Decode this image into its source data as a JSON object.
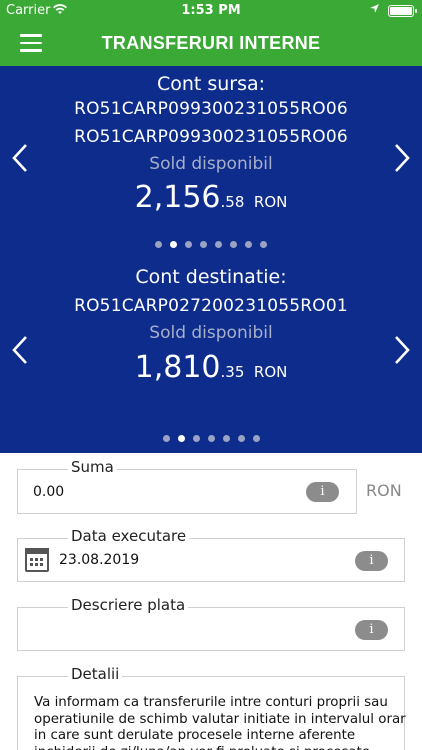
{
  "status_bar": {
    "carrier": "Carrier",
    "time": "1:53 PM"
  },
  "header": {
    "title": "TRANSFERURI INTERNE"
  },
  "source_account": {
    "label": "Cont sursa:",
    "iban_primary": "RO51CARP099300231055RO06",
    "iban_secondary": "RO51CARP099300231055RO06",
    "balance_label": "Sold disponibil",
    "balance_int": "2,156",
    "balance_dec": ".58",
    "currency": "RON",
    "page_count": 8,
    "active_page": 2
  },
  "destination_account": {
    "label": "Cont destinatie:",
    "iban": "RO51CARP027200231055RO01",
    "balance_label": "Sold disponibil",
    "balance_int": "1,810",
    "balance_dec": ".35",
    "currency": "RON",
    "page_count": 7,
    "active_page": 2
  },
  "form": {
    "amount": {
      "label": "Suma",
      "value": "0.00",
      "currency": "RON"
    },
    "execution_date": {
      "label": "Data executare",
      "value": "23.08.2019"
    },
    "payment_description": {
      "label": "Descriere plata",
      "value": ""
    },
    "details": {
      "label": "Detalii",
      "text": "Va informam ca transferurile intre conturi proprii sau operatiunile de schimb valutar initiate in intervalul orar in care sunt derulate procesele interne aferente inchiderii de zi/luna/an vor fi preluate si procesate incepand cu"
    },
    "info_glyph": "i"
  },
  "colors": {
    "green": "#3aa935",
    "navy": "#0d2c8c",
    "info_pill": "#8c8c8c"
  },
  "icons": {
    "menu": "hamburger-icon",
    "wifi": "wifi-icon",
    "location": "location-arrow-icon",
    "battery": "battery-icon",
    "prev": "chevron-left-icon",
    "next": "chevron-right-icon",
    "calendar": "calendar-icon",
    "info": "info-icon"
  }
}
